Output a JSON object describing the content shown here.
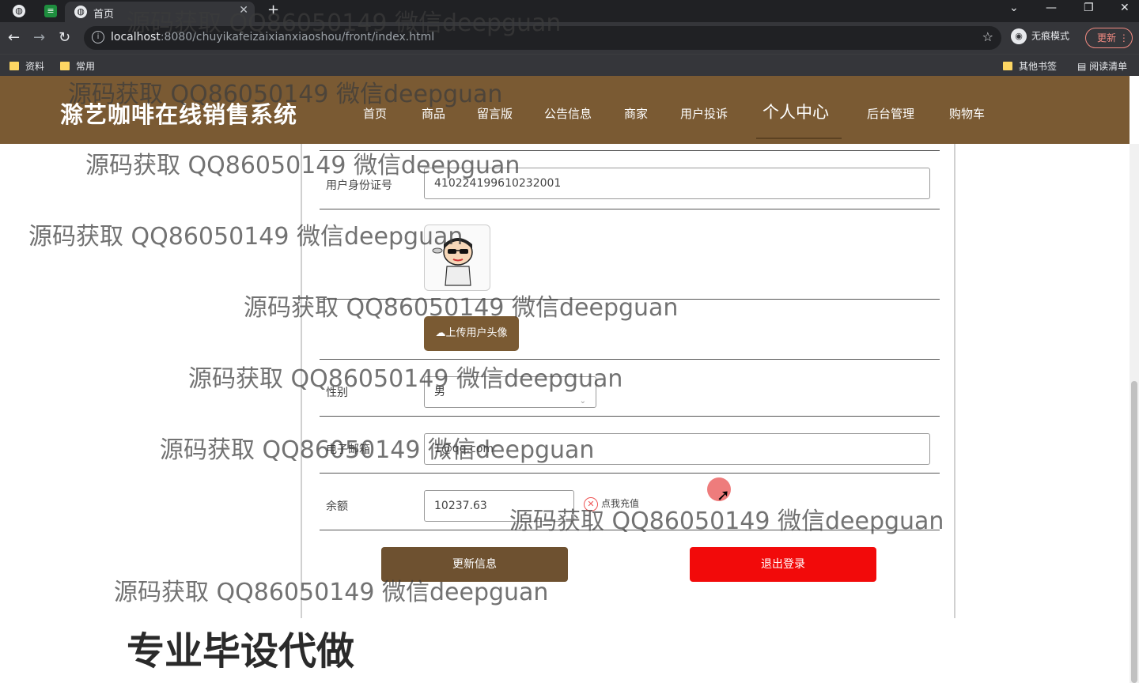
{
  "browser": {
    "tab_title": "首页",
    "url_host": "localhost",
    "url_rest": ":8080/chuyikafeizaixianxiaoshou/front/index.html",
    "incognito_label": "无痕模式",
    "update_label": "更新",
    "bookmarks": [
      "资料",
      "常用"
    ],
    "bookmarks_right": [
      "其他书签",
      "阅读清单"
    ]
  },
  "site": {
    "title": "滁艺咖啡在线销售系统",
    "nav": [
      "首页",
      "商品",
      "留言版",
      "公告信息",
      "商家",
      "用户投诉",
      "个人中心",
      "后台管理",
      "购物车"
    ],
    "active_nav": "个人中心"
  },
  "form": {
    "id_label": "用户身份证号",
    "id_value": "410224199610232001",
    "upload_label": "上传用户头像",
    "gender_label": "性别",
    "gender_value": "男",
    "email_label": "电子邮箱",
    "email_value": "1@qq.com",
    "balance_label": "余额",
    "balance_value": "10237.63",
    "recharge_label": "点我充值",
    "update_button": "更新信息",
    "logout_button": "退出登录"
  },
  "watermarks": [
    "源码获取 QQ86050149 微信deepguan",
    "源码获取 QQ86050149 微信deepguan",
    "源码获取 QQ86050149 微信deepguan",
    "源码获取 QQ86050149 微信deepguan",
    "源码获取 QQ86050149 微信deepguan",
    "源码获取 QQ86050149 微信deepguan",
    "源码获取 QQ86050149 微信deepguan",
    "源码获取 QQ86050149 微信deepguan",
    "源码获取 QQ86050149 微信deepguan"
  ],
  "promo_text": "专业毕设代做",
  "colors": {
    "header": "#7a5a33",
    "logout": "#f20a0a"
  }
}
